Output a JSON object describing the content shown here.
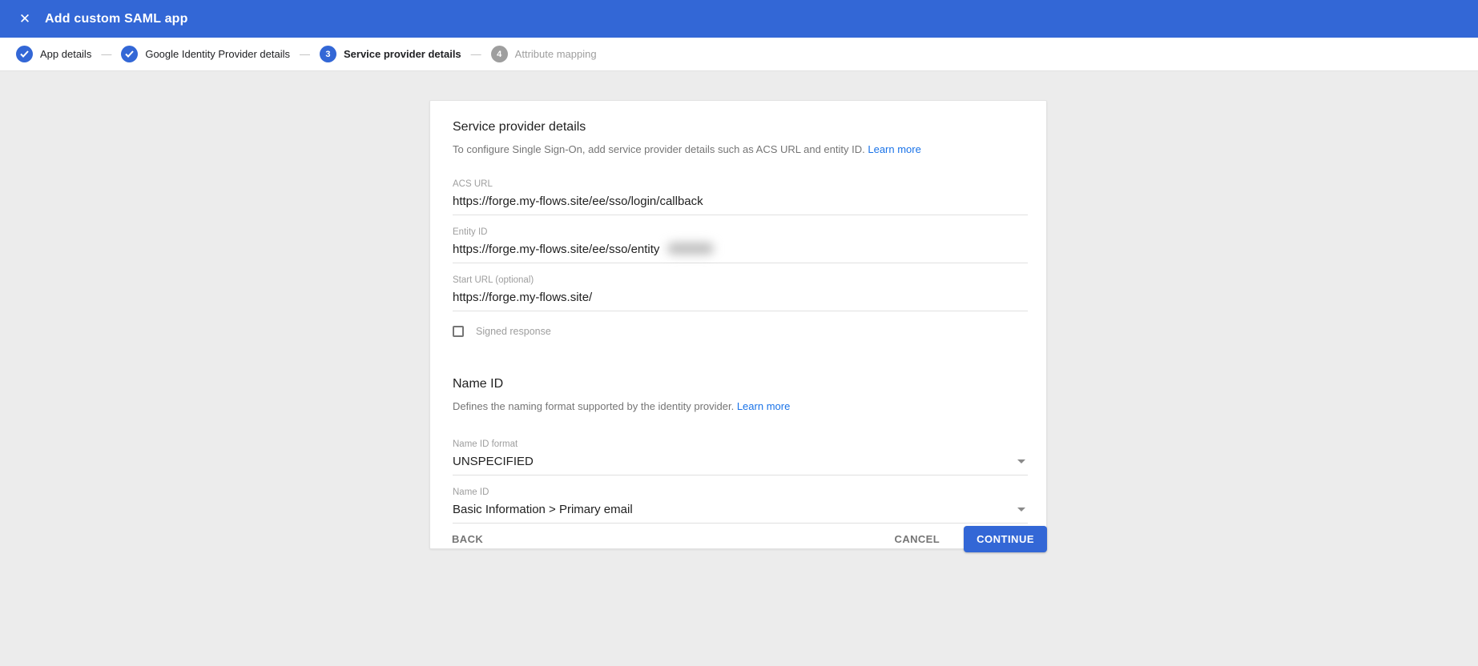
{
  "header": {
    "title": "Add custom SAML app",
    "close_icon": "✕",
    "bg_color": "#3367d6"
  },
  "stepper": {
    "separator": "—",
    "steps": [
      {
        "label": "App details",
        "state": "complete"
      },
      {
        "label": "Google Identity Provider details",
        "state": "complete"
      },
      {
        "label": "Service provider details",
        "state": "active",
        "number": "3"
      },
      {
        "label": "Attribute mapping",
        "state": "upcoming",
        "number": "4"
      }
    ]
  },
  "card": {
    "service_provider": {
      "title": "Service provider details",
      "description": "To configure Single Sign-On, add service provider details such as ACS URL and entity ID.",
      "learn_more": "Learn more",
      "fields": {
        "acs_url": {
          "label": "ACS URL",
          "value": "https://forge.my-flows.site/ee/sso/login/callback"
        },
        "entity_id": {
          "label": "Entity ID",
          "value": "https://forge.my-flows.site/ee/sso/entity",
          "redacted_suffix": true
        },
        "start_url": {
          "label": "Start URL (optional)",
          "value": "https://forge.my-flows.site/"
        }
      },
      "signed_response": {
        "label": "Signed response",
        "checked": false
      }
    },
    "name_id": {
      "title": "Name ID",
      "description": "Defines the naming format supported by the identity provider.",
      "learn_more": "Learn more",
      "format_field": {
        "label": "Name ID format",
        "value": "UNSPECIFIED"
      },
      "nameid_field": {
        "label": "Name ID",
        "value": "Basic Information > Primary email"
      }
    }
  },
  "footer": {
    "back_label": "BACK",
    "cancel_label": "CANCEL",
    "continue_label": "CONTINUE"
  },
  "colors": {
    "accent_blue": "#3367d6",
    "link_blue": "#1a73e8",
    "page_bg": "#ececec",
    "inactive_gray": "#9e9e9e"
  }
}
